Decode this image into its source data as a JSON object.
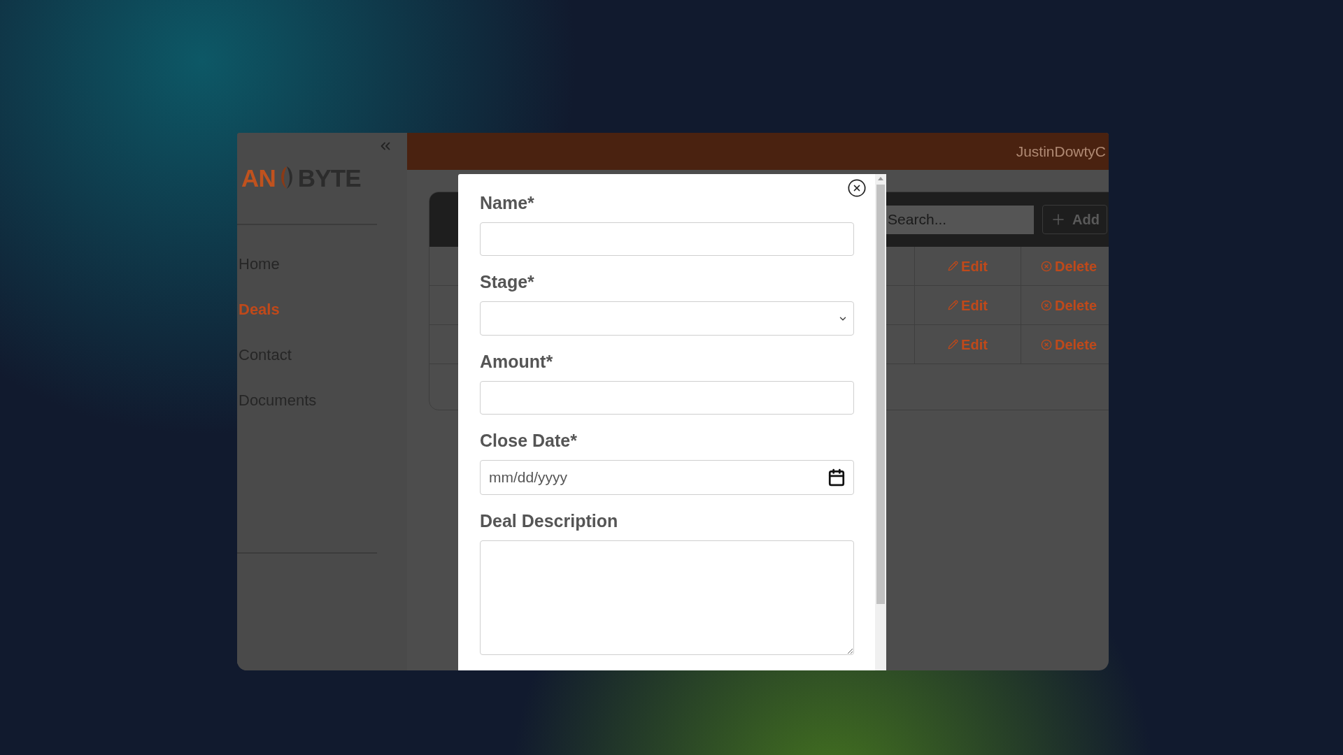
{
  "sidebar": {
    "logo": {
      "left": "AN",
      "right": "BYTE"
    },
    "nav": [
      {
        "label": "Home",
        "selected": false
      },
      {
        "label": "Deals",
        "selected": true
      },
      {
        "label": "Contact",
        "selected": false
      },
      {
        "label": "Documents",
        "selected": false
      }
    ]
  },
  "header": {
    "user": "JustinDowtyC"
  },
  "toolbar": {
    "search_placeholder": "Search...",
    "add_label": "Add"
  },
  "table": {
    "rows": [
      {
        "edit": "Edit",
        "delete": "Delete"
      },
      {
        "edit": "Edit",
        "delete": "Delete"
      },
      {
        "edit": "Edit",
        "delete": "Delete"
      }
    ]
  },
  "modal": {
    "fields": [
      {
        "kind": "text",
        "label": "Name*"
      },
      {
        "kind": "select",
        "label": "Stage*"
      },
      {
        "kind": "text",
        "label": "Amount*"
      },
      {
        "kind": "date",
        "label": "Close Date*",
        "placeholder": "mm/dd/yyyy"
      },
      {
        "kind": "textarea",
        "label": "Deal Description"
      }
    ]
  }
}
